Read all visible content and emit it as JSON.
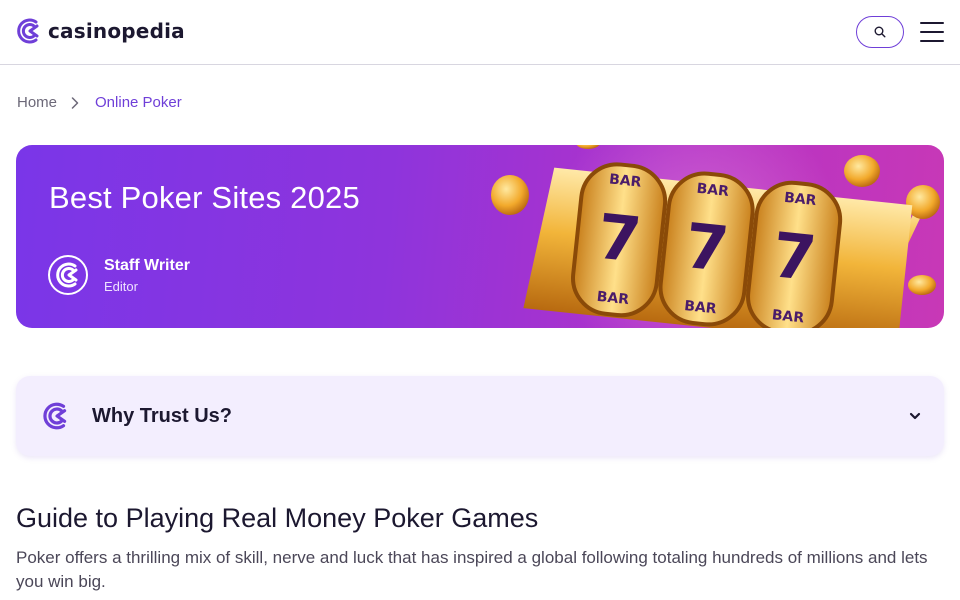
{
  "header": {
    "logo_text": "casinopedia",
    "search_icon": "search-icon",
    "menu_icon": "hamburger-menu-icon"
  },
  "breadcrumb": {
    "home": "Home",
    "separator_icon": "chevron-right-icon",
    "current": "Online Poker"
  },
  "hero": {
    "title": "Best Poker Sites 2025",
    "author_name": "Staff Writer",
    "author_role": "Editor",
    "art": "slot-machine-777-illustration"
  },
  "trust": {
    "label": "Why Trust Us?",
    "icon": "casinopedia-logo-icon",
    "chevron_icon": "chevron-down-icon"
  },
  "content": {
    "title": "Guide to Playing Real Money Poker Games",
    "paragraph": "Poker offers a thrilling mix of skill, nerve and luck that has inspired a global following totaling hundreds of millions and lets you win big."
  },
  "colors": {
    "brand": "#6f3fd8",
    "hero_start": "#7a36e8",
    "hero_end": "#c838b6",
    "trust_bg": "#f3eefe",
    "text": "#1c1830"
  }
}
